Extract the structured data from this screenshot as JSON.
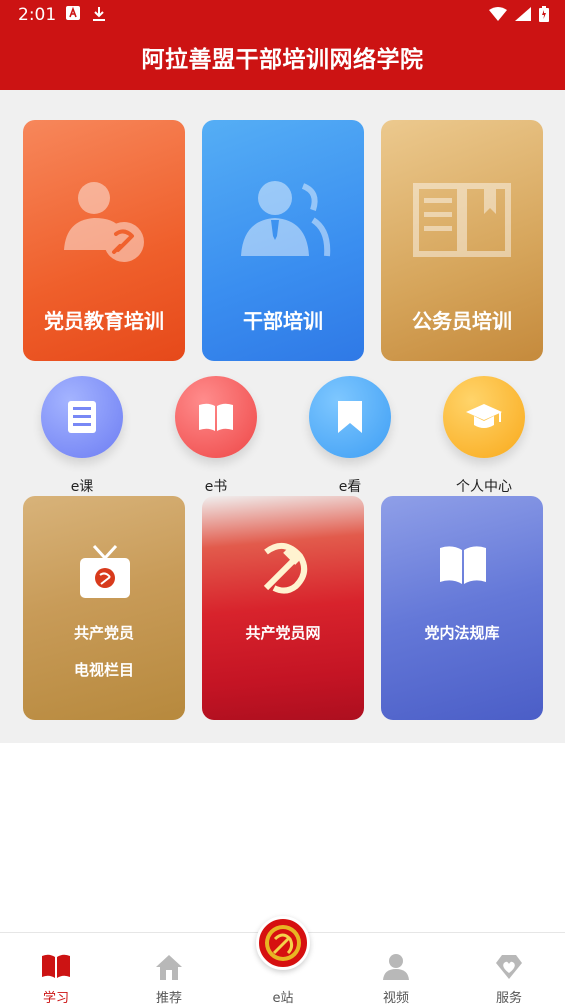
{
  "status_bar": {
    "time": "2:01"
  },
  "header": {
    "title": "阿拉善盟干部培训网络学院"
  },
  "main_cards": [
    {
      "label": "党员教育培训",
      "icon": "party-member-icon"
    },
    {
      "label": "干部培训",
      "icon": "cadre-icon"
    },
    {
      "label": "公务员培训",
      "icon": "open-book-icon"
    }
  ],
  "quick_links": [
    {
      "label": "e课",
      "icon": "course-list-icon"
    },
    {
      "label": "e书",
      "icon": "book-icon"
    },
    {
      "label": "e看",
      "icon": "bookmark-icon"
    },
    {
      "label": "个人中心",
      "icon": "graduation-cap-icon"
    }
  ],
  "tiles": [
    {
      "line1": "共产党员",
      "line2": "电视栏目",
      "icon": "tv-icon"
    },
    {
      "line1": "共产党员网",
      "icon": "hammer-sickle-icon"
    },
    {
      "line1": "党内法规库",
      "icon": "open-book-icon"
    }
  ],
  "bottom_nav": [
    {
      "label": "学习",
      "icon": "book-icon",
      "active": true
    },
    {
      "label": "推荐",
      "icon": "home-icon",
      "active": false
    },
    {
      "label": "e站",
      "icon": "party-emblem-icon",
      "active": false
    },
    {
      "label": "视频",
      "icon": "user-icon",
      "active": false
    },
    {
      "label": "服务",
      "icon": "heart-badge-icon",
      "active": false
    }
  ],
  "colors": {
    "brand_red": "#cc1313",
    "orange_card": "#ef5f2b",
    "blue_card": "#3a8ef0",
    "gold_card": "#d6a55b"
  }
}
